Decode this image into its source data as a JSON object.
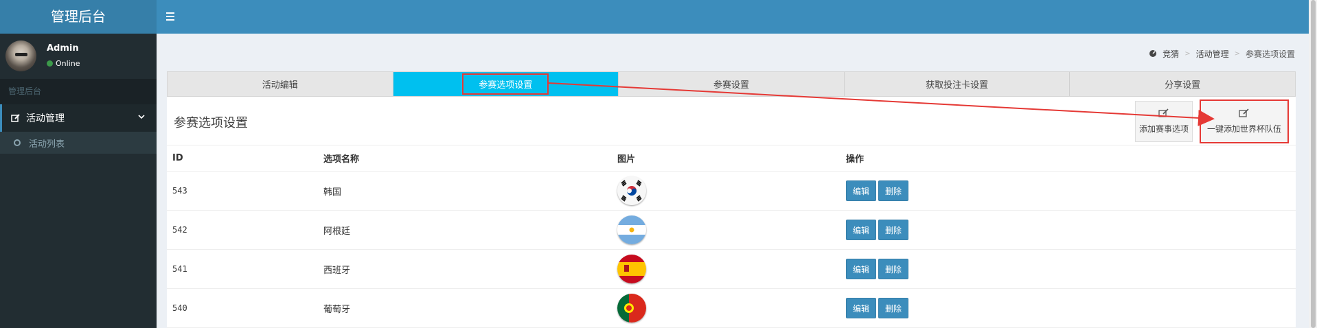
{
  "app": {
    "title": "管理后台",
    "accent": "#3c8dbc"
  },
  "user": {
    "name": "Admin",
    "status": "Online"
  },
  "sidebar": {
    "header": "管理后台",
    "menu": {
      "label": "活动管理",
      "icon": "edit-icon"
    },
    "submenu": [
      {
        "label": "活动列表"
      }
    ]
  },
  "breadcrumb": {
    "home": "竞猜",
    "level1": "活动管理",
    "current": "参赛选项设置"
  },
  "tabs": [
    {
      "label": "活动编辑"
    },
    {
      "label": "参赛选项设置",
      "active": true
    },
    {
      "label": "参赛设置"
    },
    {
      "label": "获取投注卡设置"
    },
    {
      "label": "分享设置"
    }
  ],
  "box": {
    "title": "参赛选项设置",
    "add_option_label": "添加赛事选项",
    "add_worldcup_label": "一键添加世界杯队伍"
  },
  "table": {
    "headers": {
      "id": "ID",
      "name": "选项名称",
      "image": "图片",
      "action": "操作"
    },
    "rows": [
      {
        "id": "543",
        "name": "韩国",
        "flag": "south-korea-flag-icon"
      },
      {
        "id": "542",
        "name": "阿根廷",
        "flag": "argentina-flag-icon"
      },
      {
        "id": "541",
        "name": "西班牙",
        "flag": "spain-flag-icon"
      },
      {
        "id": "540",
        "name": "葡萄牙",
        "flag": "portugal-flag-icon"
      }
    ],
    "edit_label": "编辑",
    "delete_label": "删除"
  }
}
